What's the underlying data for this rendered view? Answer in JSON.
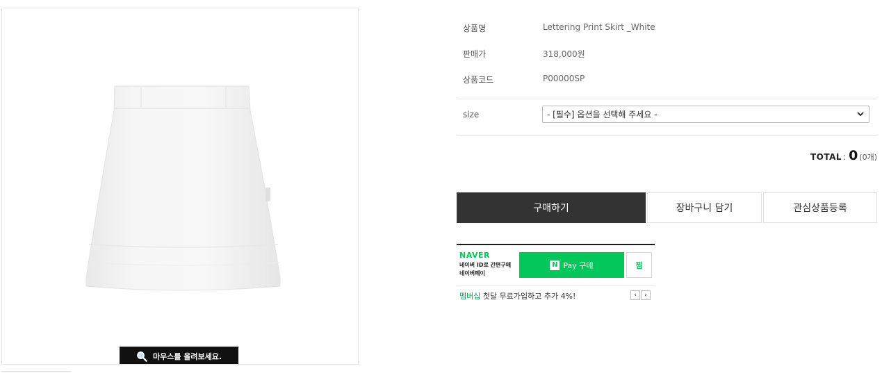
{
  "zoom_hint": "마우스를 올려보세요.",
  "product": {
    "name_label": "상품명",
    "name_value": "Lettering Print Skirt _White",
    "price_label": "판매가",
    "price_value": "318,000원",
    "code_label": "상품코드",
    "code_value": "P00000SP"
  },
  "option": {
    "size_label": "size",
    "size_selected": "- [필수] 옵션을 선택해 주세요 -"
  },
  "total": {
    "label": "TOTAL",
    "sep": ":",
    "amount": "0",
    "count": "(0개)"
  },
  "buttons": {
    "buy": "구매하기",
    "cart": "장바구니 담기",
    "wishlist": "관심상품등록"
  },
  "naver_pay": {
    "brand": "NAVER",
    "desc_line1": "네이버 ID로 간편구매",
    "desc_line2": "네이버페이",
    "pay_n": "N",
    "pay_label": "Pay 구매",
    "zzim": "찜",
    "promo_accent": "멤버십",
    "promo_text": "첫달 무료가입하고 추가 4%!",
    "prev": "‹",
    "next": "›"
  },
  "colors": {
    "naver_green": "#03c75a",
    "buy_button": "#333333"
  }
}
